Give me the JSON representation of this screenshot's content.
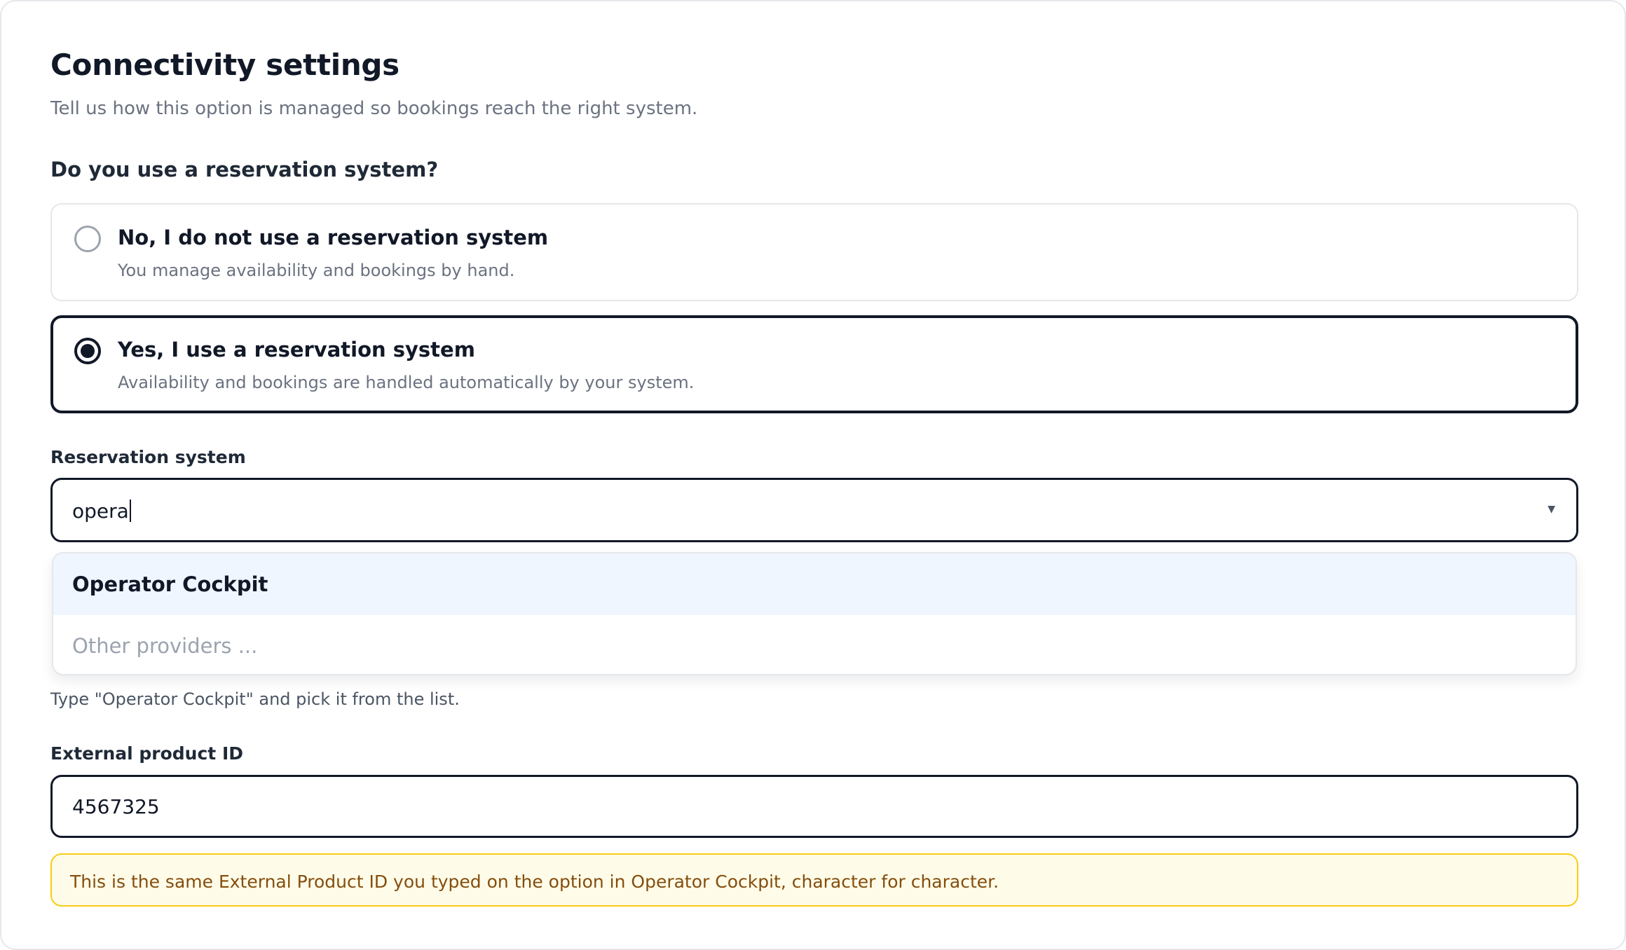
{
  "header": {
    "title": "Connectivity settings",
    "subtitle": "Tell us how this option is managed so bookings reach the right system."
  },
  "reservation_question": {
    "label": "Do you use a reservation system?",
    "options": [
      {
        "title": "No, I do not use a reservation system",
        "description": "You manage availability and bookings by hand.",
        "selected": false
      },
      {
        "title": "Yes, I use a reservation system",
        "description": "Availability and bookings are handled automatically by your system.",
        "selected": true
      }
    ]
  },
  "reservation_system": {
    "label": "Reservation system",
    "value": "opera",
    "dropdown_icon": "chevron-down-icon",
    "suggestions": [
      {
        "label": "Operator Cockpit",
        "highlighted": true
      },
      {
        "label": "Other providers ...",
        "muted": true
      }
    ],
    "hint": "Type \"Operator Cockpit\" and pick it from the list."
  },
  "external_product": {
    "label": "External product ID",
    "value": "4567325",
    "notice": "This is the same External Product ID you typed on the option in Operator Cockpit, character for character."
  },
  "colors": {
    "text_primary": "#111827",
    "text_muted": "#6b7280",
    "selected_border": "#111827",
    "dropdown_highlight": "#eff6ff",
    "notice_background": "#fefce8",
    "notice_border": "#facc15",
    "notice_text": "#854d0e"
  }
}
